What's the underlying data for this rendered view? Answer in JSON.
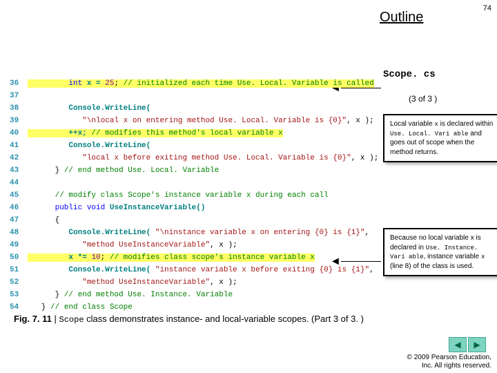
{
  "page_number": "74",
  "outline_heading": "Outline",
  "side": {
    "filename": "Scope. cs",
    "counter": "(3 of 3 )"
  },
  "callouts": {
    "c1_p1": "Local variable ",
    "c1_x": "x",
    "c1_p2": " is declared within ",
    "c1_id": "Use. Local. Vari able",
    "c1_p3": " and goes out of scope when the method returns.",
    "c2_p1": "Because no local variable x is declared in ",
    "c2_id": "Use. Instance. Vari able",
    "c2_p2": ", instance variable ",
    "c2_x": "x",
    "c2_p3": " (line 8) of the class is used."
  },
  "caption": {
    "fignum": "Fig. 7. 11",
    "sep": " | ",
    "cls": "Scope",
    "rest": " class demonstrates instance- and local-variable scopes. (Part 3 of 3. )"
  },
  "copyright": {
    "l1": "© 2009 Pearson Education,",
    "l2": "Inc.  All rights reserved."
  },
  "lines": {
    "l36": {
      "n": "36",
      "ind": "         ",
      "kw": "int",
      "sp": " ",
      "id": "x = ",
      "num": "25",
      "semi": ";",
      "cm": " // initialized each time Use. Local. Variable is called"
    },
    "l37": {
      "n": "37",
      "ind": ""
    },
    "l38": {
      "n": "38",
      "ind": "         ",
      "id": "Console.WriteLine("
    },
    "l39": {
      "n": "39",
      "ind": "            ",
      "str": "\"\\nlocal x on entering method Use. Local. Variable is {0}\"",
      "rest": ", x );"
    },
    "l40": {
      "n": "40",
      "ind": "         ",
      "id": "++x;",
      "cm": " // modifies this method's local variable x"
    },
    "l41": {
      "n": "41",
      "ind": "         ",
      "id": "Console.WriteLine("
    },
    "l42": {
      "n": "42",
      "ind": "            ",
      "str": "\"local x before exiting method Use. Local. Variable is {0}\"",
      "rest": ", x );"
    },
    "l43": {
      "n": "43",
      "ind": "      } ",
      "cm": "// end method Use. Local. Variable"
    },
    "l44": {
      "n": "44",
      "ind": ""
    },
    "l45": {
      "n": "45",
      "ind": "      ",
      "cm": "// modify class Scope's instance variable x during each call"
    },
    "l46": {
      "n": "46",
      "ind": "      ",
      "kw": "public void",
      "sp": " ",
      "id": "UseInstanceVariable()"
    },
    "l47": {
      "n": "47",
      "ind": "      {"
    },
    "l48": {
      "n": "48",
      "ind": "         ",
      "id": "Console.WriteLine( ",
      "str": "\"\\ninstance variable x on entering {0} is {1}\"",
      "rest": ","
    },
    "l49": {
      "n": "49",
      "ind": "            ",
      "str": "\"method UseInstanceVariable\"",
      "rest": ", x );"
    },
    "l50": {
      "n": "50",
      "ind": "         ",
      "id": "x *= ",
      "num": "10",
      "semi": ";",
      "cm": " // modifies class scope's instance variable x"
    },
    "l51": {
      "n": "51",
      "ind": "         ",
      "id": "Console.WriteLine( ",
      "str": "\"instance variable x before exiting {0} is {1}\"",
      "rest": ","
    },
    "l52": {
      "n": "52",
      "ind": "            ",
      "str": "\"method UseInstanceVariable\"",
      "rest": ", x );"
    },
    "l53": {
      "n": "53",
      "ind": "      } ",
      "cm": "// end method Use. Instance. Variable"
    },
    "l54": {
      "n": "54",
      "ind": "   } ",
      "cm": "// end class Scope"
    }
  }
}
